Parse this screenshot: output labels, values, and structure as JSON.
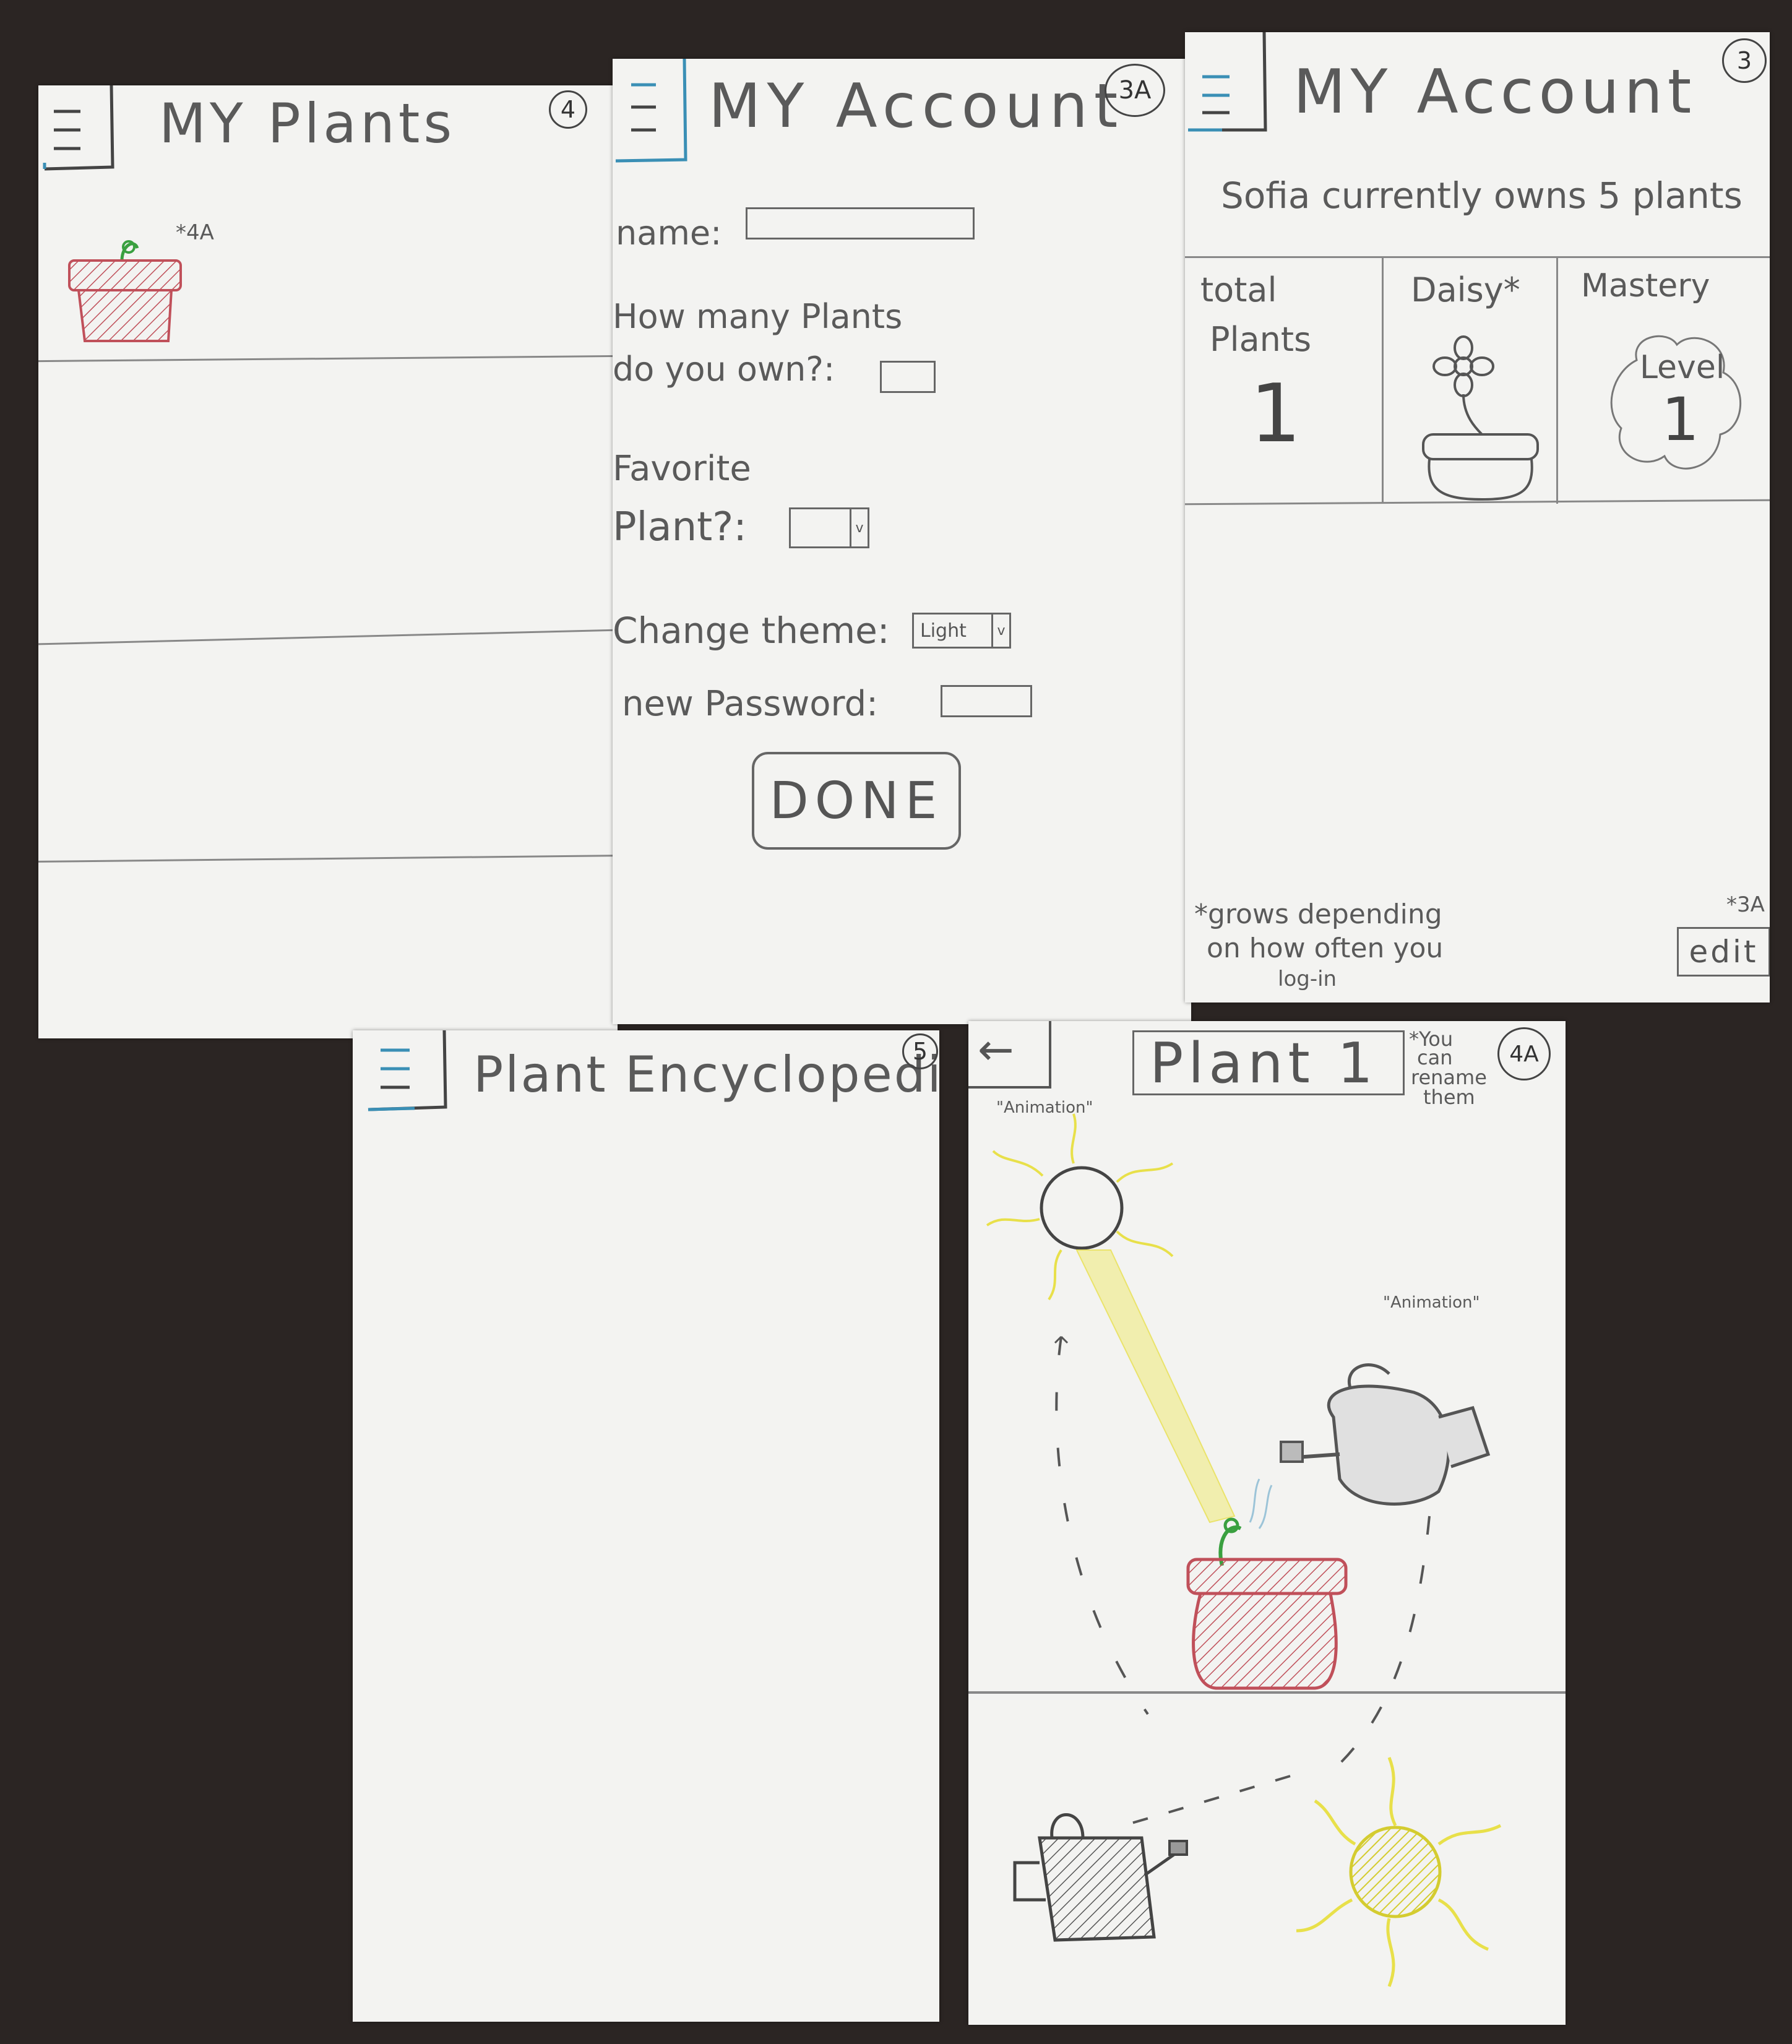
{
  "screens": {
    "my_plants": {
      "title": "MY Plants",
      "number": "4",
      "plant_note": "*4A"
    },
    "my_account_edit": {
      "title": "MY Account",
      "number": "3A",
      "name_label": "name:",
      "plants_label_line1": "How many Plants",
      "plants_label_line2": "do you own?:",
      "favorite_label_line1": "Favorite",
      "favorite_label_line2": "Plant?:",
      "theme_label": "Change theme:",
      "theme_value": "Light",
      "password_label": "new Password:",
      "done_label": "DONE"
    },
    "my_account": {
      "title": "MY Account",
      "number": "3",
      "summary": "Sofia currently owns 5 plants",
      "col1_label_line1": "total",
      "col1_label_line2": "Plants",
      "col1_value": "1",
      "col2_label": "Daisy*",
      "col3_label": "Mastery",
      "col3_level_label": "Level",
      "col3_level_value": "1",
      "footnote_line1": "*grows depending",
      "footnote_line2": "on how often you",
      "footnote_line3": "log-in",
      "edit_note": "*3A",
      "edit_label": "edit"
    },
    "encyclopedia": {
      "title": "Plant Encyclopedia",
      "number": "5"
    },
    "plant_detail": {
      "back_icon": "←",
      "plant_name": "Plant 1",
      "rename_note_line1": "*You",
      "rename_note_line2": "can",
      "rename_note_line3": "rename",
      "rename_note_line4": "them",
      "number": "4A",
      "animation_label_1": "\"Animation\"",
      "animation_label_2": "\"Animation\""
    }
  },
  "colors": {
    "background": "#2b2523",
    "paper": "#f3f3f1",
    "menu_blue": "#3a8fb5",
    "pot_red": "#c0505a",
    "sprout_green": "#3aa040",
    "sun_yellow": "#e8e04a"
  }
}
